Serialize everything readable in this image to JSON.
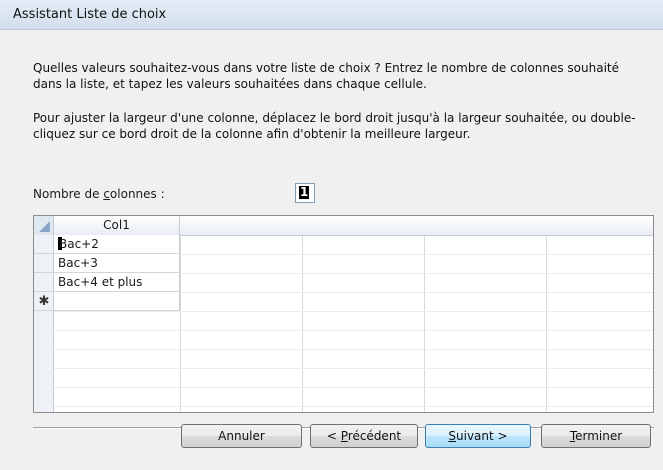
{
  "window": {
    "title": "Assistant Liste de choix"
  },
  "instructions": {
    "p1": "Quelles valeurs souhaitez-vous dans votre liste de choix ? Entrez le nombre de colonnes souhaité dans la liste, et tapez les valeurs souhaitées dans chaque cellule.",
    "p2": "Pour ajuster la largeur d'une colonne, déplacez le bord droit jusqu'à la largeur souhaitée, ou double-cliquez sur ce bord droit de la colonne afin d'obtenir la meilleure largeur."
  },
  "columns_field": {
    "label_pre": "Nombre de ",
    "label_u": "c",
    "label_post": "olonnes :",
    "value": "1"
  },
  "grid": {
    "column_header": "Col1",
    "rows": [
      "Bac+2",
      "Bac+3",
      "Bac+4 et plus"
    ],
    "new_row_marker": "✱"
  },
  "buttons": {
    "cancel": "Annuler",
    "previous_pre": "< ",
    "previous_u": "P",
    "previous_post": "récédent",
    "next_u": "S",
    "next_post": "uivant >",
    "finish_u": "T",
    "finish_post": "erminer"
  }
}
